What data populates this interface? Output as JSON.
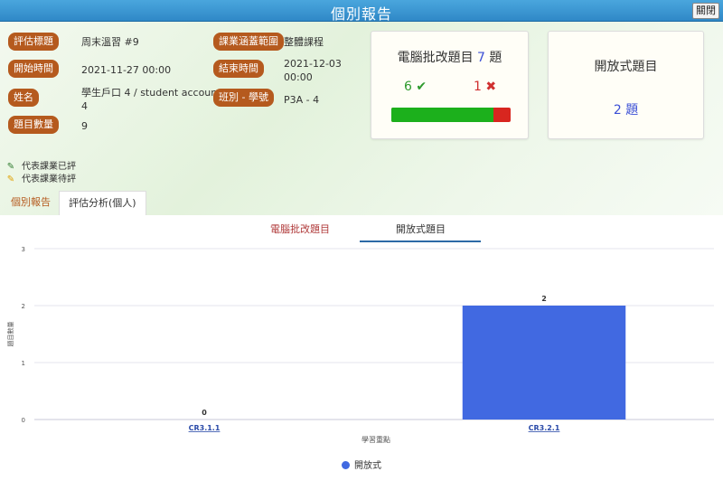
{
  "window": {
    "title": "個別報告",
    "close_label": "關閉"
  },
  "info": {
    "assessment_title_label": "評估標題",
    "assessment_title": "周末溫習 #9",
    "scope_label": "課業涵蓋範圍",
    "scope": "整體課程",
    "start_label": "開始時間",
    "start": "2021-11-27 00:00",
    "end_label": "結束時間",
    "end_line1": "2021-12-03",
    "end_line2": "00:00",
    "name_label": "姓名",
    "name_line1": "學生戶口 4 / student account",
    "name_line2": "4",
    "class_label": "班別 - 學號",
    "class": "P3A - 4",
    "count_label": "題目數量",
    "count": "9"
  },
  "auto_card": {
    "title_prefix": "電腦批改題目",
    "title_count": "7",
    "title_suffix": "題",
    "correct": "6",
    "wrong": "1",
    "correct_fraction": 0.857
  },
  "open_card": {
    "title": "開放式題目",
    "count": "2",
    "unit": "題"
  },
  "legend": {
    "graded": "代表課業已評",
    "pending": "代表課業待評"
  },
  "tabs": {
    "report": "個別報告",
    "analysis": "評估分析(個人)"
  },
  "subtabs": {
    "auto": "電腦批改題目",
    "open": "開放式題目"
  },
  "colors": {
    "label_bg": "#b55a1e",
    "accent": "#3b4fd6",
    "bar": "#4169e1",
    "correct": "#1cb01c",
    "wrong": "#d8261f"
  },
  "chart_data": {
    "type": "bar",
    "categories": [
      "CR3.1.1",
      "CR3.2.1"
    ],
    "series": [
      {
        "name": "開放式",
        "values": [
          0,
          2
        ]
      }
    ],
    "xlabel": "學習重點",
    "ylabel": "題目數量",
    "ylim": [
      0,
      3
    ],
    "yticks": [
      0,
      1,
      2,
      3
    ],
    "grid": true,
    "legend_position": "bottom"
  }
}
